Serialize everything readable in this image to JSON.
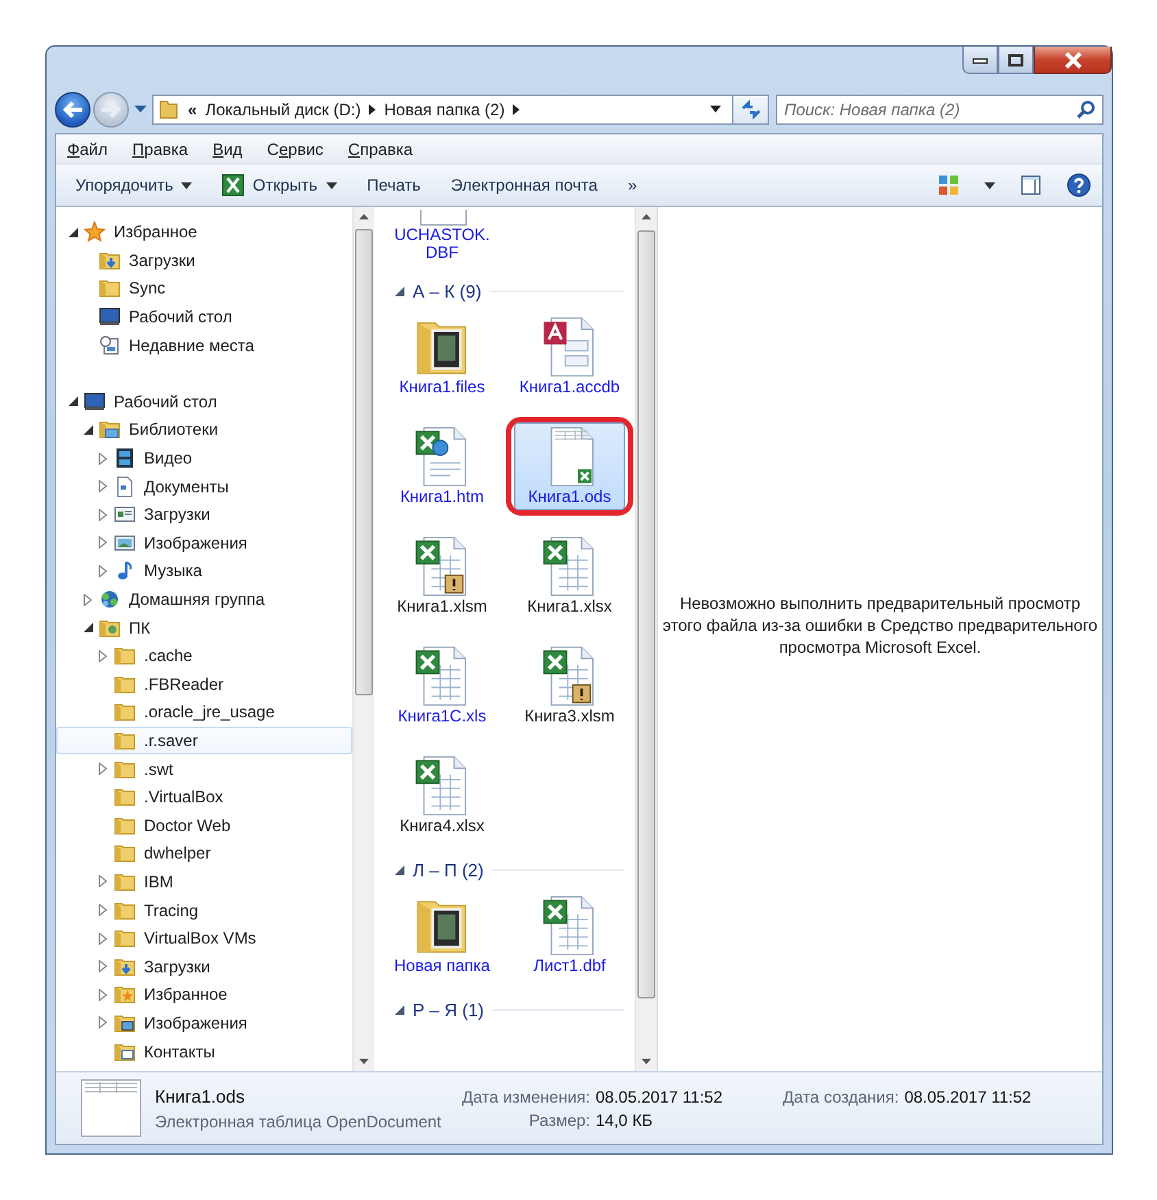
{
  "address_bar": {
    "overflow_marker": "«",
    "breadcrumbs": [
      "Локальный диск (D:)",
      "Новая папка (2)"
    ]
  },
  "search": {
    "placeholder": "Поиск: Новая папка (2)"
  },
  "menu": [
    {
      "key": "Ф",
      "after": "айл"
    },
    {
      "key": "П",
      "after": "равка"
    },
    {
      "key": "В",
      "after": "ид"
    },
    {
      "before": "С",
      "key": "е",
      "after": "рвис"
    },
    {
      "key": "С",
      "after": "правка"
    }
  ],
  "toolbar": [
    {
      "label": "Упорядочить",
      "kind": "plain",
      "dropdown": true
    },
    {
      "label": "Открыть",
      "kind": "excel",
      "dropdown": true
    },
    {
      "label": "Печать",
      "kind": "plain",
      "dropdown": false
    },
    {
      "label": "Электронная почта",
      "kind": "plain",
      "dropdown": false
    },
    {
      "label": "»",
      "kind": "plain",
      "dropdown": false
    }
  ],
  "navigation": [
    {
      "label": "Избранное",
      "kind": "star",
      "expanded": true,
      "selected": false,
      "children": [
        {
          "label": "Загрузки",
          "kind": "downloads",
          "selected": false
        },
        {
          "label": "Sync",
          "kind": "folder",
          "selected": false
        },
        {
          "label": "Рабочий стол",
          "kind": "desktop",
          "selected": false
        },
        {
          "label": "Недавние места",
          "kind": "recent",
          "selected": false
        }
      ]
    },
    {
      "label": "Рабочий стол",
      "kind": "desktop",
      "expanded": true,
      "selected": false,
      "children": [
        {
          "label": "Библиотеки",
          "kind": "library",
          "expanded": true,
          "selected": false,
          "children": [
            {
              "label": "Видео",
              "kind": "video",
              "expanded": false,
              "selected": false
            },
            {
              "label": "Документы",
              "kind": "documents",
              "expanded": false,
              "selected": false
            },
            {
              "label": "Загрузки",
              "kind": "window",
              "expanded": false,
              "selected": false
            },
            {
              "label": "Изображения",
              "kind": "pictures",
              "expanded": false,
              "selected": false
            },
            {
              "label": "Музыка",
              "kind": "music",
              "expanded": false,
              "selected": false
            }
          ]
        },
        {
          "label": "Домашняя группа",
          "kind": "homegroup",
          "expanded": false,
          "selected": false
        },
        {
          "label": "ПК",
          "kind": "user",
          "expanded": true,
          "selected": false,
          "children": [
            {
              "label": ".cache",
              "kind": "folder",
              "expanded": false,
              "selected": false
            },
            {
              "label": ".FBReader",
              "kind": "folder",
              "selected": false
            },
            {
              "label": ".oracle_jre_usage",
              "kind": "folder",
              "selected": false
            },
            {
              "label": ".r.saver",
              "kind": "folder",
              "selected": true
            },
            {
              "label": ".swt",
              "kind": "folder",
              "expanded": false,
              "selected": false
            },
            {
              "label": ".VirtualBox",
              "kind": "folder",
              "selected": false
            },
            {
              "label": "Doctor Web",
              "kind": "folder",
              "selected": false
            },
            {
              "label": "dwhelper",
              "kind": "folder",
              "selected": false
            },
            {
              "label": "IBM",
              "kind": "folder",
              "expanded": false,
              "selected": false
            },
            {
              "label": "Tracing",
              "kind": "folder",
              "expanded": false,
              "selected": false
            },
            {
              "label": "VirtualBox VMs",
              "kind": "folder",
              "expanded": false,
              "selected": false
            },
            {
              "label": "Загрузки",
              "kind": "downloads",
              "expanded": false,
              "selected": false
            },
            {
              "label": "Избранное",
              "kind": "favorites",
              "expanded": false,
              "selected": false
            },
            {
              "label": "Изображения",
              "kind": "pictures-folder",
              "expanded": false,
              "selected": false
            },
            {
              "label": "Контакты",
              "kind": "contacts",
              "selected": false
            }
          ]
        }
      ]
    }
  ],
  "files": {
    "items_above": [
      {
        "name": "UCHASTOK.DBF",
        "compressed": true,
        "selected": false
      }
    ],
    "groups": [
      {
        "title": "А – К (9)",
        "expanded": true,
        "items": [
          {
            "name": "Книга1.files",
            "kind": "folder-media",
            "compressed": true,
            "selected": false
          },
          {
            "name": "Книга1.accdb",
            "kind": "access",
            "compressed": true,
            "selected": false
          },
          {
            "name": "Книга1.htm",
            "kind": "excel-web",
            "compressed": true,
            "selected": false
          },
          {
            "name": "Книга1.ods",
            "kind": "ods",
            "compressed": true,
            "selected": true
          },
          {
            "name": "Книга1.xlsm",
            "kind": "excel-macro",
            "compressed": false,
            "selected": false
          },
          {
            "name": "Книга1.xlsx",
            "kind": "excel",
            "compressed": false,
            "selected": false
          },
          {
            "name": "Книга1C.xls",
            "kind": "excel",
            "compressed": true,
            "selected": false
          },
          {
            "name": "Книга3.xlsm",
            "kind": "excel-macro",
            "compressed": false,
            "selected": false
          },
          {
            "name": "Книга4.xlsx",
            "kind": "excel",
            "compressed": false,
            "selected": false
          }
        ]
      },
      {
        "title": "Л – П (2)",
        "expanded": true,
        "items": [
          {
            "name": "Новая папка",
            "kind": "folder-media",
            "compressed": true,
            "selected": false
          },
          {
            "name": "Лист1.dbf",
            "kind": "dbf",
            "compressed": true,
            "selected": false
          }
        ]
      },
      {
        "title": "Р – Я (1)",
        "expanded": true
      }
    ]
  },
  "preview": {
    "message": "Невозможно выполнить предварительный просмотр этого файла из-за ошибки в Средство предварительного просмотра Microsoft Excel."
  },
  "details": {
    "name": "Книга1.ods",
    "type": "Электронная таблица OpenDocument",
    "fields": [
      {
        "label": "Дата изменения:",
        "value": "08.05.2017 11:52"
      },
      {
        "label": "Размер:",
        "value": "14,0 КБ"
      },
      {
        "label": "Дата создания:",
        "value": "08.05.2017 11:52"
      }
    ]
  }
}
